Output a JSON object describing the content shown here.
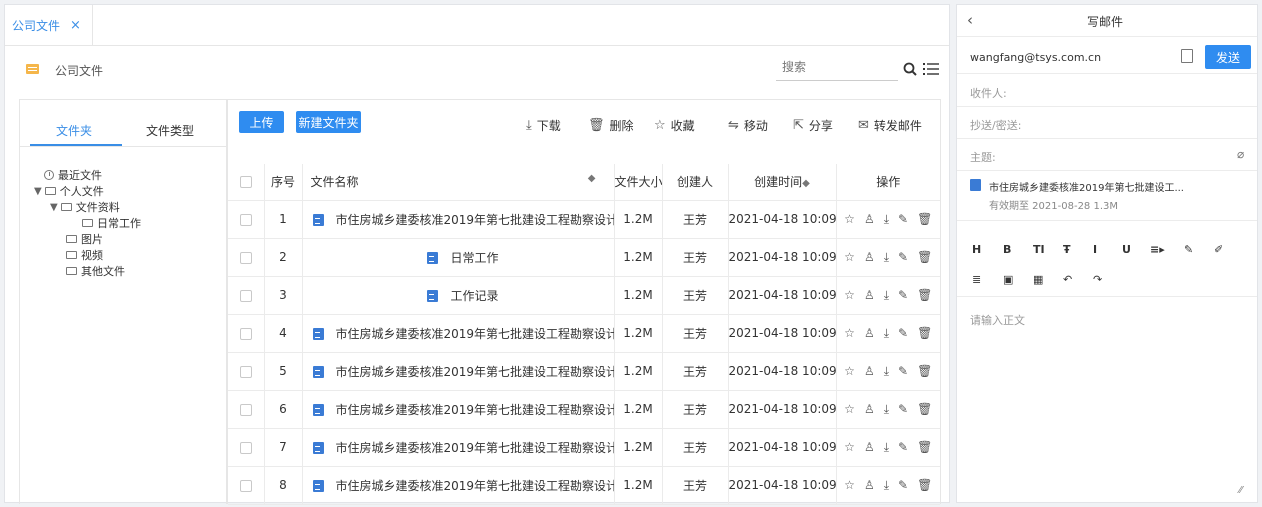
{
  "tab": {
    "label": "公司文件",
    "close": "×"
  },
  "breadcrumb": {
    "label": "公司文件"
  },
  "search": {
    "placeholder": "搜索"
  },
  "tree": {
    "tabs": [
      "文件夹",
      "文件类型"
    ],
    "nodes": [
      {
        "label": "最近文件"
      },
      {
        "label": "个人文件"
      },
      {
        "label": "文件资料"
      },
      {
        "label": "日常工作"
      },
      {
        "label": "图片"
      },
      {
        "label": "视频"
      },
      {
        "label": "其他文件"
      }
    ]
  },
  "toolbar": {
    "upload": "上传",
    "new_folder": "新建文件夹",
    "download": "下载",
    "delete": "删除",
    "favorite": "收藏",
    "move": "移动",
    "share": "分享",
    "forward": "转发邮件"
  },
  "table": {
    "headers": {
      "index": "序号",
      "name": "文件名称",
      "size": "文件大小",
      "creator": "创建人",
      "created": "创建时间",
      "ops": "操作"
    },
    "rows": [
      {
        "index": "1",
        "name": "市住房城乡建委核准2019年第七批建设工程勘察设计...",
        "size": "1.2M",
        "creator": "王芳",
        "created": "2021-04-18 10:09"
      },
      {
        "index": "2",
        "name": "日常工作",
        "size": "1.2M",
        "creator": "王芳",
        "created": "2021-04-18 10:09"
      },
      {
        "index": "3",
        "name": "工作记录",
        "size": "1.2M",
        "creator": "王芳",
        "created": "2021-04-18 10:09"
      },
      {
        "index": "4",
        "name": "市住房城乡建委核准2019年第七批建设工程勘察设计...",
        "size": "1.2M",
        "creator": "王芳",
        "created": "2021-04-18 10:09"
      },
      {
        "index": "5",
        "name": "市住房城乡建委核准2019年第七批建设工程勘察设计...",
        "size": "1.2M",
        "creator": "王芳",
        "created": "2021-04-18 10:09"
      },
      {
        "index": "6",
        "name": "市住房城乡建委核准2019年第七批建设工程勘察设计...",
        "size": "1.2M",
        "creator": "王芳",
        "created": "2021-04-18 10:09"
      },
      {
        "index": "7",
        "name": "市住房城乡建委核准2019年第七批建设工程勘察设计...",
        "size": "1.2M",
        "creator": "王芳",
        "created": "2021-04-18 10:09"
      },
      {
        "index": "8",
        "name": "市住房城乡建委核准2019年第七批建设工程勘察设计...",
        "size": "1.2M",
        "creator": "王芳",
        "created": "2021-04-18 10:09"
      }
    ]
  },
  "mail": {
    "title": "写邮件",
    "from": "wangfang@tsys.com.cn",
    "send": "发送",
    "to_label": "收件人:",
    "cc_label": "抄送/密送:",
    "subject_label": "主题:",
    "attachment": {
      "name": "市住房城乡建委核准2019年第七批建设工...",
      "meta": "有效期至 2021-08-28   1.3M"
    },
    "toolbar_row1": [
      "H",
      "B",
      "TI",
      "Ŧ",
      "I",
      "U",
      "≡▸",
      "✎",
      "✐"
    ],
    "toolbar_row2": [
      "≣",
      "▣",
      "▦",
      "↶",
      "↷"
    ],
    "body_placeholder": "请输入正文"
  },
  "colors": {
    "accent": "#2f8cf0",
    "tab_text": "#3a8ee6",
    "folder": "#f5b64a"
  }
}
